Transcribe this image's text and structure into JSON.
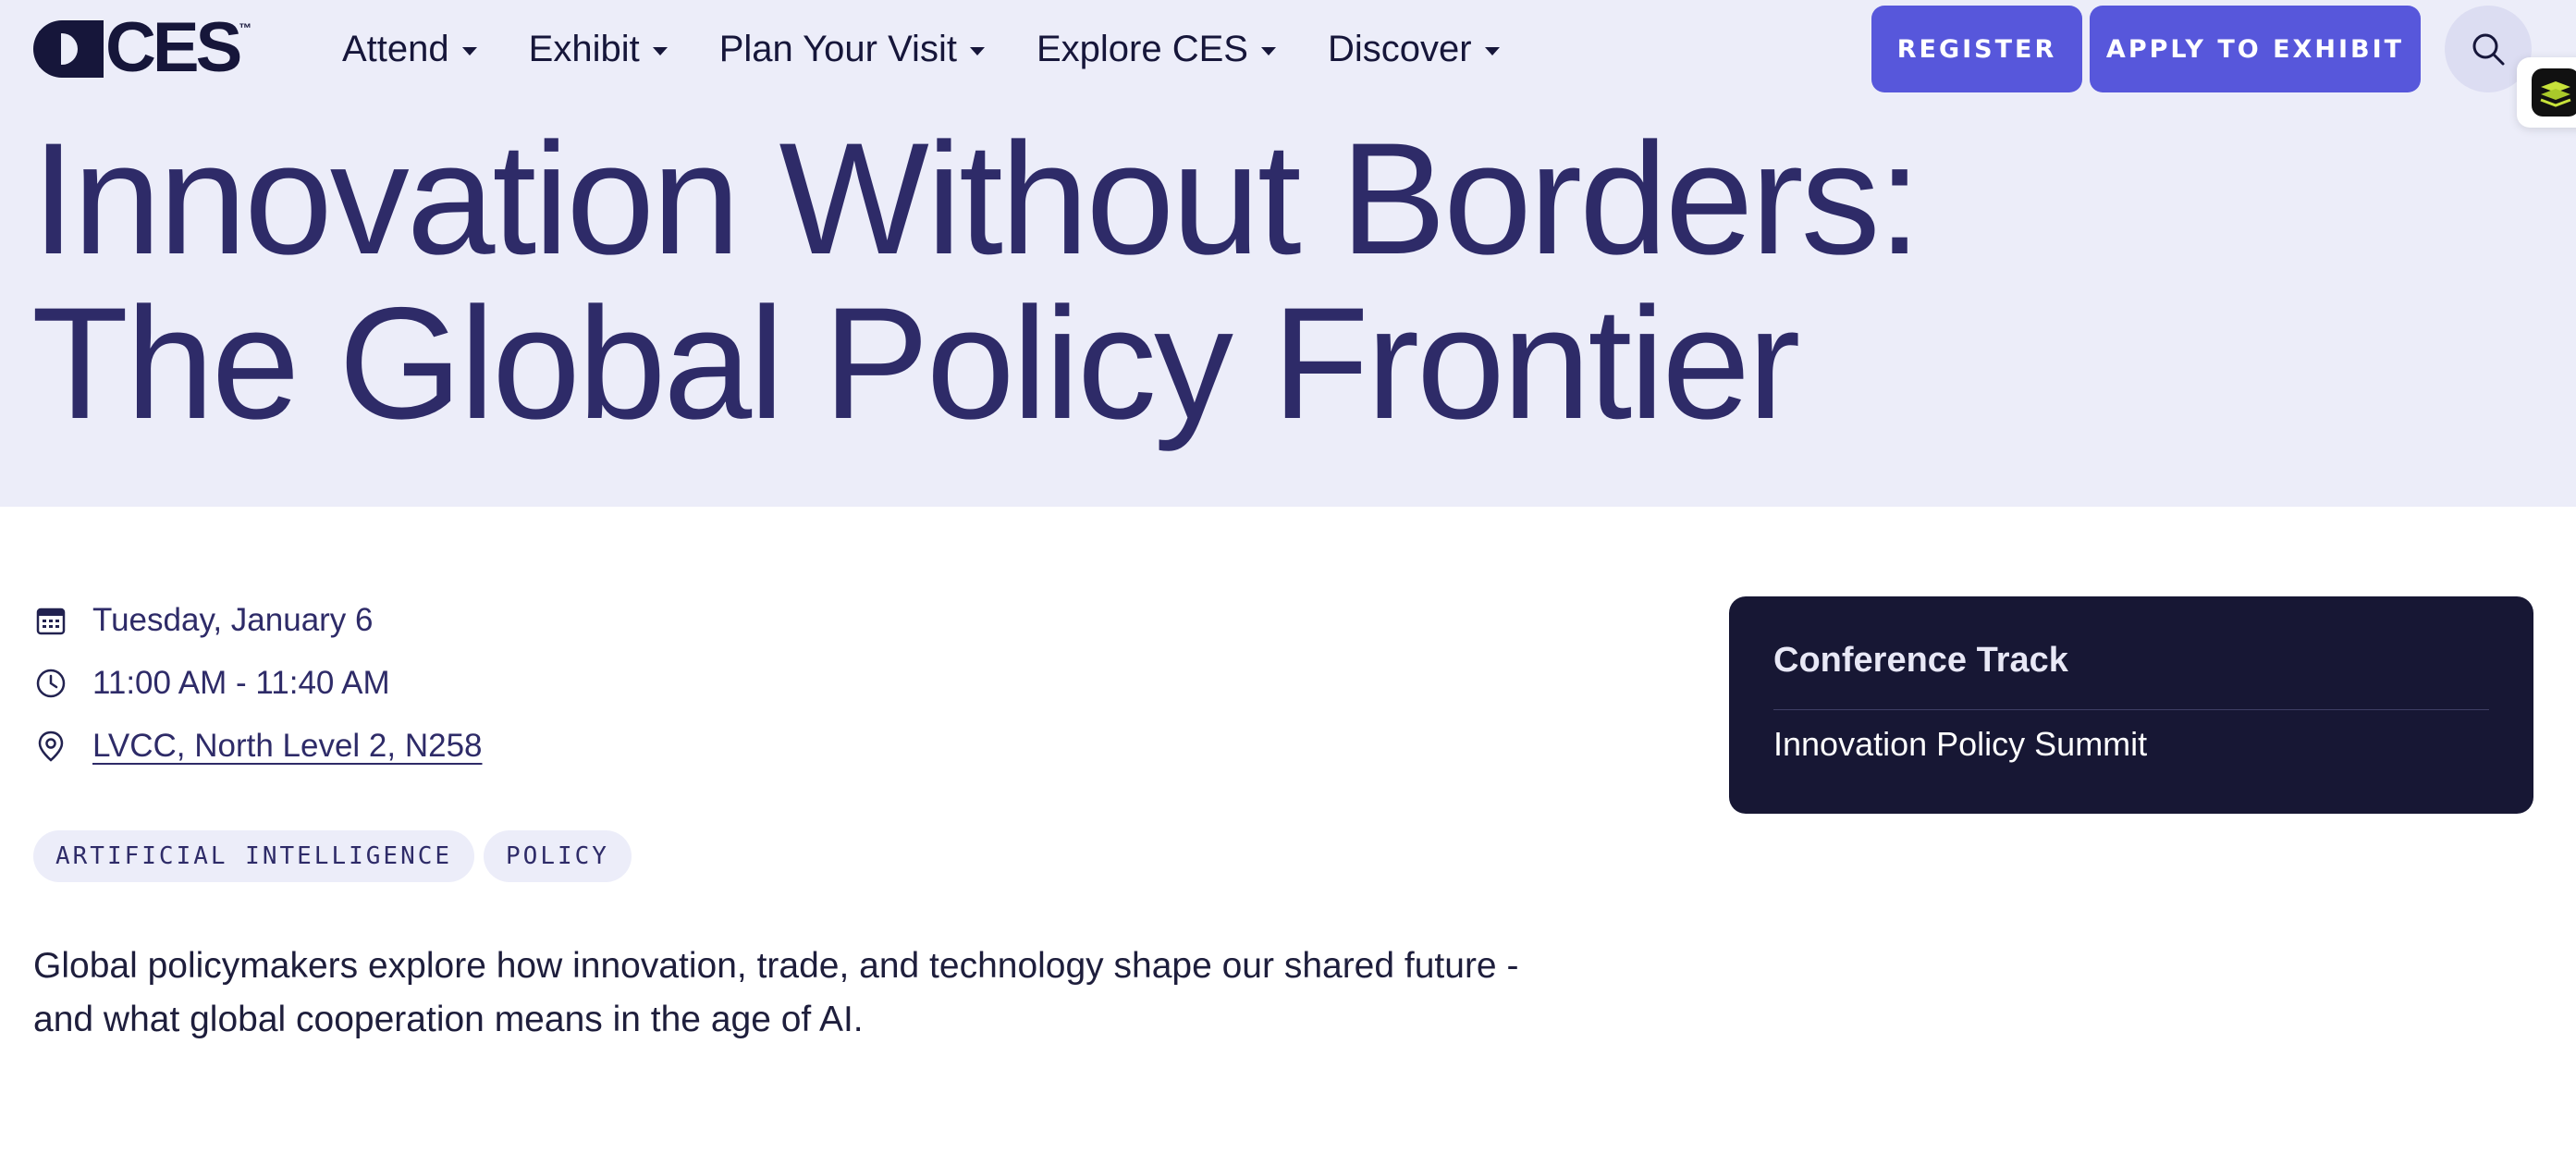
{
  "brand": {
    "logo_text": "CES",
    "logo_tm": "™"
  },
  "nav": {
    "items": [
      {
        "label": "Attend"
      },
      {
        "label": "Exhibit"
      },
      {
        "label": "Plan Your Visit"
      },
      {
        "label": "Explore CES"
      },
      {
        "label": "Discover"
      }
    ]
  },
  "header": {
    "register_label": "REGISTER",
    "apply_label": "APPLY TO EXHIBIT",
    "search_icon": "search-icon"
  },
  "session": {
    "title": "Innovation Without Borders: The Global Policy Frontier",
    "date": "Tuesday, January 6",
    "time": "11:00 AM - 11:40 AM",
    "location": "LVCC, North Level 2, N258",
    "tags": [
      "ARTIFICIAL INTELLIGENCE",
      "POLICY"
    ],
    "description": "Global policymakers explore how innovation, trade, and technology shape our shared future - and what global cooperation means in the age of AI."
  },
  "track": {
    "heading": "Conference Track",
    "value": "Innovation Policy Summit"
  },
  "colors": {
    "hero_bg": "#ECEDF9",
    "accent": "#5757DB",
    "title": "#2E2B68",
    "card_bg": "#171734"
  }
}
